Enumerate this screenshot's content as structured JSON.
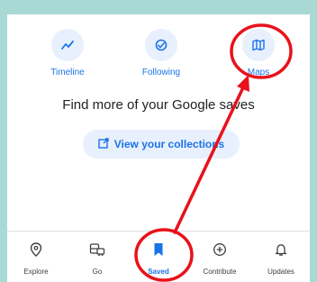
{
  "top_tabs": [
    {
      "label": "Timeline",
      "icon": "timeline-icon"
    },
    {
      "label": "Following",
      "icon": "following-icon"
    },
    {
      "label": "Maps",
      "icon": "maps-icon"
    }
  ],
  "heading": "Find more of your Google saves",
  "collections_button": {
    "label": "View your collections",
    "icon": "open-external-icon"
  },
  "bottom_nav": [
    {
      "label": "Explore",
      "icon": "location-pin-icon",
      "active": false
    },
    {
      "label": "Go",
      "icon": "commute-icon",
      "active": false
    },
    {
      "label": "Saved",
      "icon": "bookmark-icon",
      "active": true
    },
    {
      "label": "Contribute",
      "icon": "add-circle-icon",
      "active": false
    },
    {
      "label": "Updates",
      "icon": "bell-icon",
      "active": false
    }
  ],
  "colors": {
    "accent": "#1a73e8",
    "annotation": "#e8121a",
    "backdrop": "#a9d9d5"
  }
}
